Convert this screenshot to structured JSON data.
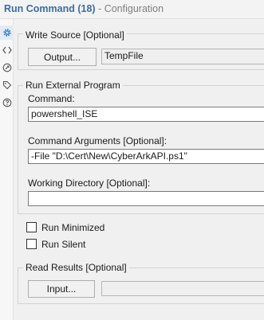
{
  "header": {
    "tool_name": "Run Command (18)",
    "separator": " - ",
    "subtitle": "Configuration"
  },
  "rail": {
    "icons": [
      "gear-icon",
      "code-icon",
      "annotation-icon",
      "tag-icon",
      "help-icon"
    ]
  },
  "write_source": {
    "legend": "Write Source [Optional]",
    "output_button": "Output...",
    "value": "TempFile"
  },
  "external_program": {
    "legend": "Run External Program",
    "command_label": "Command:",
    "command_value": "powershell_ISE",
    "args_label": "Command Arguments [Optional]:",
    "args_value": "-File \"D:\\Cert\\New\\CyberArkAPI.ps1\"",
    "workdir_label": "Working Directory [Optional]:",
    "workdir_value": ""
  },
  "options": {
    "run_minimized_label": "Run Minimized",
    "run_minimized_checked": false,
    "run_silent_label": "Run Silent",
    "run_silent_checked": false
  },
  "read_results": {
    "legend": "Read Results [Optional]",
    "input_button": "Input...",
    "value": ""
  },
  "colors": {
    "tool_name": "#3b6ea5",
    "subtitle": "#808080",
    "panel_bg": "#f0f0f0"
  }
}
